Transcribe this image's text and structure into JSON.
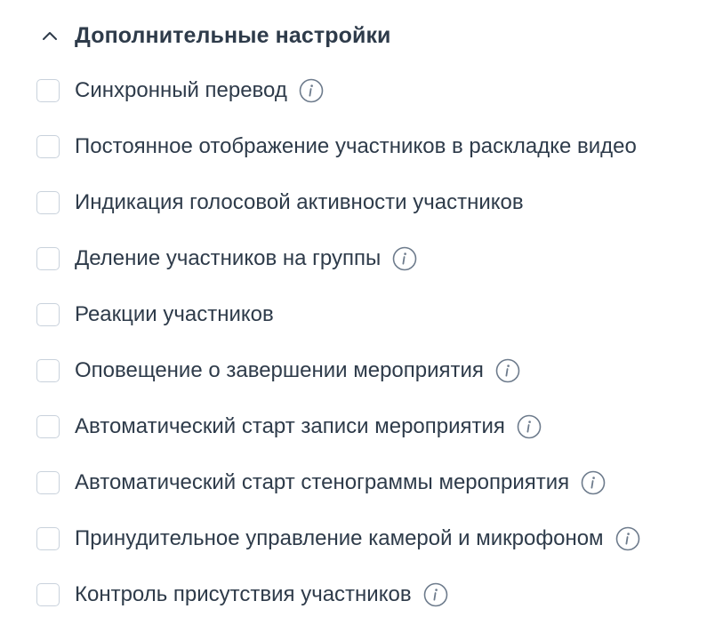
{
  "section": {
    "title": "Дополнительные настройки",
    "expanded": true,
    "chevron_icon": "chevron-up-icon"
  },
  "colors": {
    "text": "#2e3b4a",
    "checkbox_border": "#c9d2dc",
    "info_icon": "#6d7b8c"
  },
  "options": [
    {
      "label": "Синхронный перевод",
      "checked": false,
      "has_info": true,
      "info_icon": "info-icon"
    },
    {
      "label": "Постоянное отображение участников в раскладке видео",
      "checked": false,
      "has_info": false
    },
    {
      "label": "Индикация голосовой активности участников",
      "checked": false,
      "has_info": false
    },
    {
      "label": "Деление участников на группы",
      "checked": false,
      "has_info": true,
      "info_icon": "info-icon"
    },
    {
      "label": "Реакции участников",
      "checked": false,
      "has_info": false
    },
    {
      "label": "Оповещение о завершении мероприятия",
      "checked": false,
      "has_info": true,
      "info_icon": "info-icon"
    },
    {
      "label": "Автоматический старт записи мероприятия",
      "checked": false,
      "has_info": true,
      "info_icon": "info-icon"
    },
    {
      "label": "Автоматический старт стенограммы мероприятия",
      "checked": false,
      "has_info": true,
      "info_icon": "info-icon"
    },
    {
      "label": "Принудительное управление камерой и микрофоном",
      "checked": false,
      "has_info": true,
      "info_icon": "info-icon"
    },
    {
      "label": "Контроль присутствия участников",
      "checked": false,
      "has_info": true,
      "info_icon": "info-icon"
    }
  ]
}
